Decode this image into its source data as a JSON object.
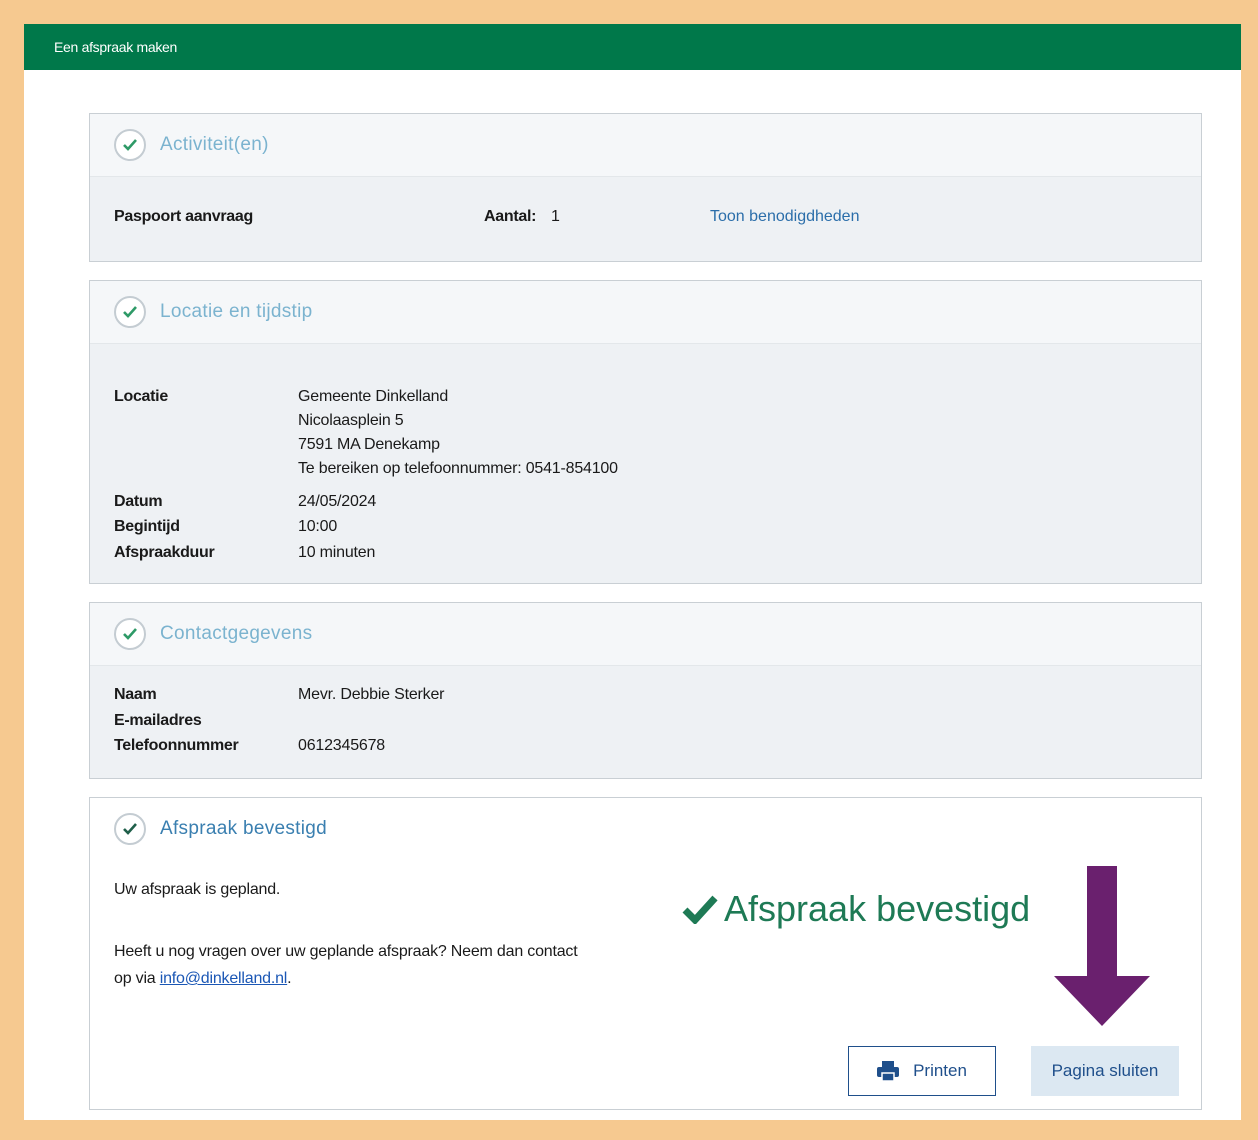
{
  "topbar": {
    "title": "Een afspraak maken"
  },
  "activities": {
    "title": "Activiteit(en)",
    "item_name": "Paspoort aanvraag",
    "count_label": "Aantal:",
    "count_value": "1",
    "link": "Toon benodigdheden"
  },
  "location": {
    "title": "Locatie en tijdstip",
    "location_label": "Locatie",
    "location_lines": [
      "Gemeente Dinkelland",
      "Nicolaasplein 5",
      "7591 MA Denekamp",
      "Te bereiken op telefoonnummer: 0541-854100"
    ],
    "date_label": "Datum",
    "date_value": "24/05/2024",
    "start_label": "Begintijd",
    "start_value": "10:00",
    "duration_label": "Afspraakduur",
    "duration_value": "10 minuten"
  },
  "contact": {
    "title": "Contactgegevens",
    "name_label": "Naam",
    "name_value": "Mevr. Debbie Sterker",
    "email_label": "E-mailadres",
    "email_value": "",
    "phone_label": "Telefoonnummer",
    "phone_value": "0612345678"
  },
  "confirmed": {
    "title": "Afspraak bevestigd",
    "planned_text": "Uw afspraak is gepland.",
    "question_line1": "Heeft u nog vragen over uw geplande afspraak? Neem dan contact",
    "question_prefix": "op via ",
    "email_link": "info@dinkelland.nl",
    "question_suffix": ".",
    "big_status": "Afspraak bevestigd",
    "print_button": "Printen",
    "close_button": "Pagina sluiten"
  },
  "colors": {
    "topbar": "#00784a",
    "frame": "#f6c990",
    "check": "#1e7a55",
    "arrow": "#6a206e",
    "link": "#2b6eaa"
  }
}
